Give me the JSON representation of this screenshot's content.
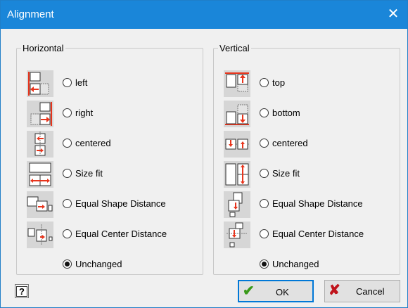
{
  "window": {
    "title": "Alignment",
    "close_glyph": "✕"
  },
  "horizontal": {
    "legend": "Horizontal",
    "options": [
      {
        "label": "left",
        "icon": "align-left-icon",
        "checked": false
      },
      {
        "label": "right",
        "icon": "align-right-icon",
        "checked": false
      },
      {
        "label": "centered",
        "icon": "align-center-horizontal-icon",
        "checked": false
      },
      {
        "label": "Size fit",
        "icon": "size-fit-horizontal-icon",
        "checked": false
      },
      {
        "label": "Equal Shape Distance",
        "icon": "equal-shape-distance-horizontal-icon",
        "checked": false
      },
      {
        "label": "Equal Center Distance",
        "icon": "equal-center-distance-horizontal-icon",
        "checked": false
      },
      {
        "label": "Unchanged",
        "checked": true
      }
    ]
  },
  "vertical": {
    "legend": "Vertical",
    "options": [
      {
        "label": "top",
        "icon": "align-top-icon",
        "checked": false
      },
      {
        "label": "bottom",
        "icon": "align-bottom-icon",
        "checked": false
      },
      {
        "label": "centered",
        "icon": "align-center-vertical-icon",
        "checked": false
      },
      {
        "label": "Size fit",
        "icon": "size-fit-vertical-icon",
        "checked": false
      },
      {
        "label": "Equal Shape Distance",
        "icon": "equal-shape-distance-vertical-icon",
        "checked": false
      },
      {
        "label": "Equal Center Distance",
        "icon": "equal-center-distance-vertical-icon",
        "checked": false
      },
      {
        "label": "Unchanged",
        "checked": true
      }
    ]
  },
  "buttons": {
    "help_glyph": "?",
    "ok_label": "OK",
    "ok_icon": "checkmark-icon",
    "cancel_label": "Cancel",
    "cancel_icon": "cross-icon"
  },
  "colors": {
    "title_bar": "#1a86d9",
    "arrow_red": "#e8341c",
    "selection_blue": "#0078d7"
  }
}
